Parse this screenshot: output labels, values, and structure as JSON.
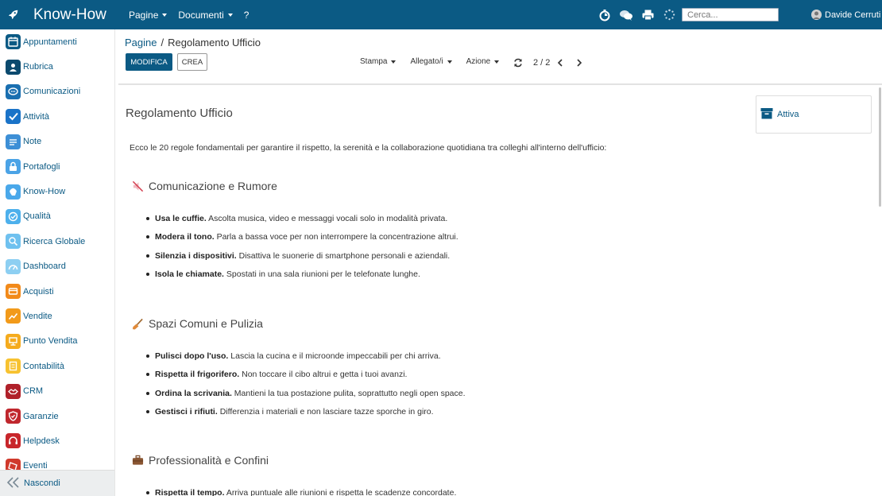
{
  "app": {
    "title": "Know-How",
    "menu": [
      {
        "label": "Pagine",
        "has_dropdown": true
      },
      {
        "label": "Documenti",
        "has_dropdown": true
      },
      {
        "label": "?",
        "has_dropdown": false
      }
    ],
    "search_placeholder": "Cerca...",
    "user_name": "Davide Cerruti",
    "header_icons": [
      "timer-icon",
      "chat-icon",
      "print-icon",
      "spinner-icon"
    ]
  },
  "sidebar": {
    "items": [
      {
        "label": "Appuntamenti",
        "icon": "calendar-icon",
        "color": "#0b5a84"
      },
      {
        "label": "Rubrica",
        "icon": "contacts-icon",
        "color": "#0b4a6e"
      },
      {
        "label": "Comunicazioni",
        "icon": "speech-bubble-icon",
        "color": "#1a6fb0"
      },
      {
        "label": "Attività",
        "icon": "checkbox-icon",
        "color": "#1a73c8"
      },
      {
        "label": "Note",
        "icon": "note-icon",
        "color": "#3d8fd6"
      },
      {
        "label": "Portafogli",
        "icon": "lock-icon",
        "color": "#4ba3e6"
      },
      {
        "label": "Know-How",
        "icon": "brain-icon",
        "color": "#4aa8ea"
      },
      {
        "label": "Qualità",
        "icon": "quality-icon",
        "color": "#4db0ec"
      },
      {
        "label": "Ricerca Globale",
        "icon": "search-icon",
        "color": "#6fc1ef"
      },
      {
        "label": "Dashboard",
        "icon": "dashboard-icon",
        "color": "#8dcff2"
      },
      {
        "label": "Acquisti",
        "icon": "cart-icon",
        "color": "#f28a1a"
      },
      {
        "label": "Vendite",
        "icon": "chart-icon",
        "color": "#f29a1a"
      },
      {
        "label": "Punto Vendita",
        "icon": "pos-icon",
        "color": "#f5ab1d"
      },
      {
        "label": "Contabilità",
        "icon": "ledger-icon",
        "color": "#f7c230"
      },
      {
        "label": "CRM",
        "icon": "handshake-icon",
        "color": "#b0212a"
      },
      {
        "label": "Garanzie",
        "icon": "shield-icon",
        "color": "#c0272d"
      },
      {
        "label": "Helpdesk",
        "icon": "headset-icon",
        "color": "#c8262b"
      },
      {
        "label": "Eventi",
        "icon": "ticket-icon",
        "color": "#d03a2c"
      }
    ],
    "collapse_label": "Nascondi"
  },
  "toolbar": {
    "breadcrumb_parent": "Pagine",
    "breadcrumb_separator": "/",
    "breadcrumb_current": "Regolamento Ufficio",
    "edit_label": "MODIFICA",
    "create_label": "CREA",
    "actions": [
      "Stampa",
      "Allegato/i",
      "Azione"
    ],
    "pager_value": "2 / 2"
  },
  "document": {
    "title": "Regolamento Ufficio",
    "intro": "Ecco le 20 regole fondamentali per garantire il rispetto, la serenità e la collaborazione quotidiana tra colleghi all'interno dell'ufficio:",
    "status_label": "Attiva",
    "sections": [
      {
        "heading": "Comunicazione e Rumore",
        "icon": "muted-speaker-icon",
        "items": [
          {
            "bold": "Usa le cuffie.",
            "text": " Ascolta musica, video e messaggi vocali solo in modalità privata."
          },
          {
            "bold": "Modera il tono.",
            "text": " Parla a bassa voce per non interrompere la concentrazione altrui."
          },
          {
            "bold": "Silenzia i dispositivi.",
            "text": " Disattiva le suonerie di smartphone personali e aziendali."
          },
          {
            "bold": "Isola le chiamate.",
            "text": " Spostati in una sala riunioni per le telefonate lunghe."
          }
        ]
      },
      {
        "heading": "Spazi Comuni e Pulizia",
        "icon": "broom-icon",
        "items": [
          {
            "bold": "Pulisci dopo l'uso.",
            "text": " Lascia la cucina e il microonde impeccabili per chi arriva."
          },
          {
            "bold": "Rispetta il frigorifero.",
            "text": " Non toccare il cibo altrui e getta i tuoi avanzi."
          },
          {
            "bold": "Ordina la scrivania.",
            "text": " Mantieni la tua postazione pulita, soprattutto negli open space."
          },
          {
            "bold": "Gestisci i rifiuti.",
            "text": " Differenzia i materiali e non lasciare tazze sporche in giro."
          }
        ]
      },
      {
        "heading": "Professionalità e Confini",
        "icon": "briefcase-icon",
        "items": [
          {
            "bold": "Rispetta il tempo.",
            "text": " Arriva puntuale alle riunioni e rispetta le scadenze concordate."
          }
        ]
      }
    ]
  }
}
